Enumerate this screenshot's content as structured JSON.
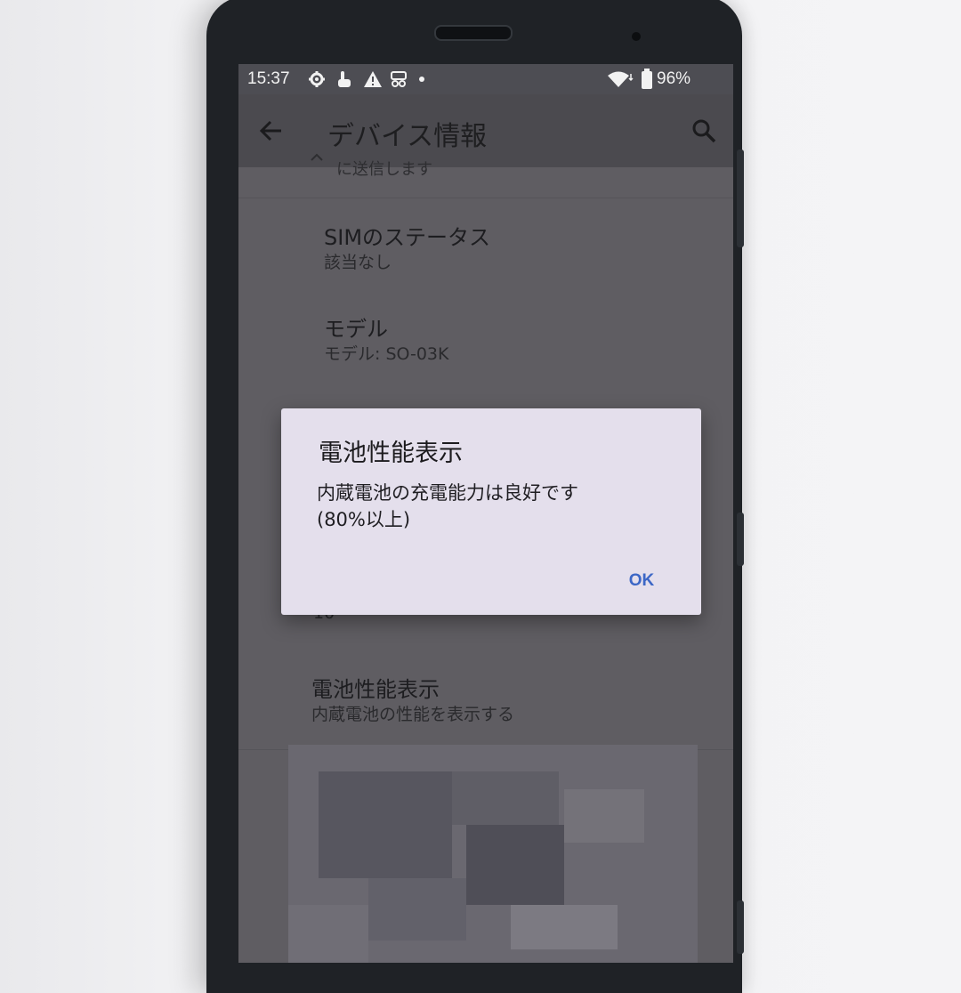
{
  "status_bar": {
    "time": "15:37",
    "battery": "96%",
    "left_icons": [
      "gear-icon",
      "touch-icon",
      "warning-icon",
      "cast-icon",
      "dot-icon"
    ],
    "right_icons": [
      "wifi-icon",
      "battery-icon"
    ]
  },
  "app_bar": {
    "title": "デバイス情報",
    "back_icon": "arrow-left-icon",
    "search_icon": "search-icon"
  },
  "list": {
    "partial_top_text": "に送信します",
    "items": [
      {
        "title": "SIMのステータス",
        "subtitle": "該当なし"
      },
      {
        "title": "モデル",
        "subtitle": "モデル: SO-03K"
      },
      {
        "title": "電池性能表示",
        "subtitle": "内蔵電池の性能を表示する"
      }
    ],
    "hidden_row_fragment": "10"
  },
  "dialog": {
    "title": "電池性能表示",
    "message_line1": "内蔵電池の充電能力は良好です",
    "message_line2": "(80%以上)",
    "ok_label": "OK"
  },
  "colors": {
    "accent": "#3c67c6",
    "dialog_bg": "#e4dfec",
    "scrim_screen": "#5f5d62"
  }
}
